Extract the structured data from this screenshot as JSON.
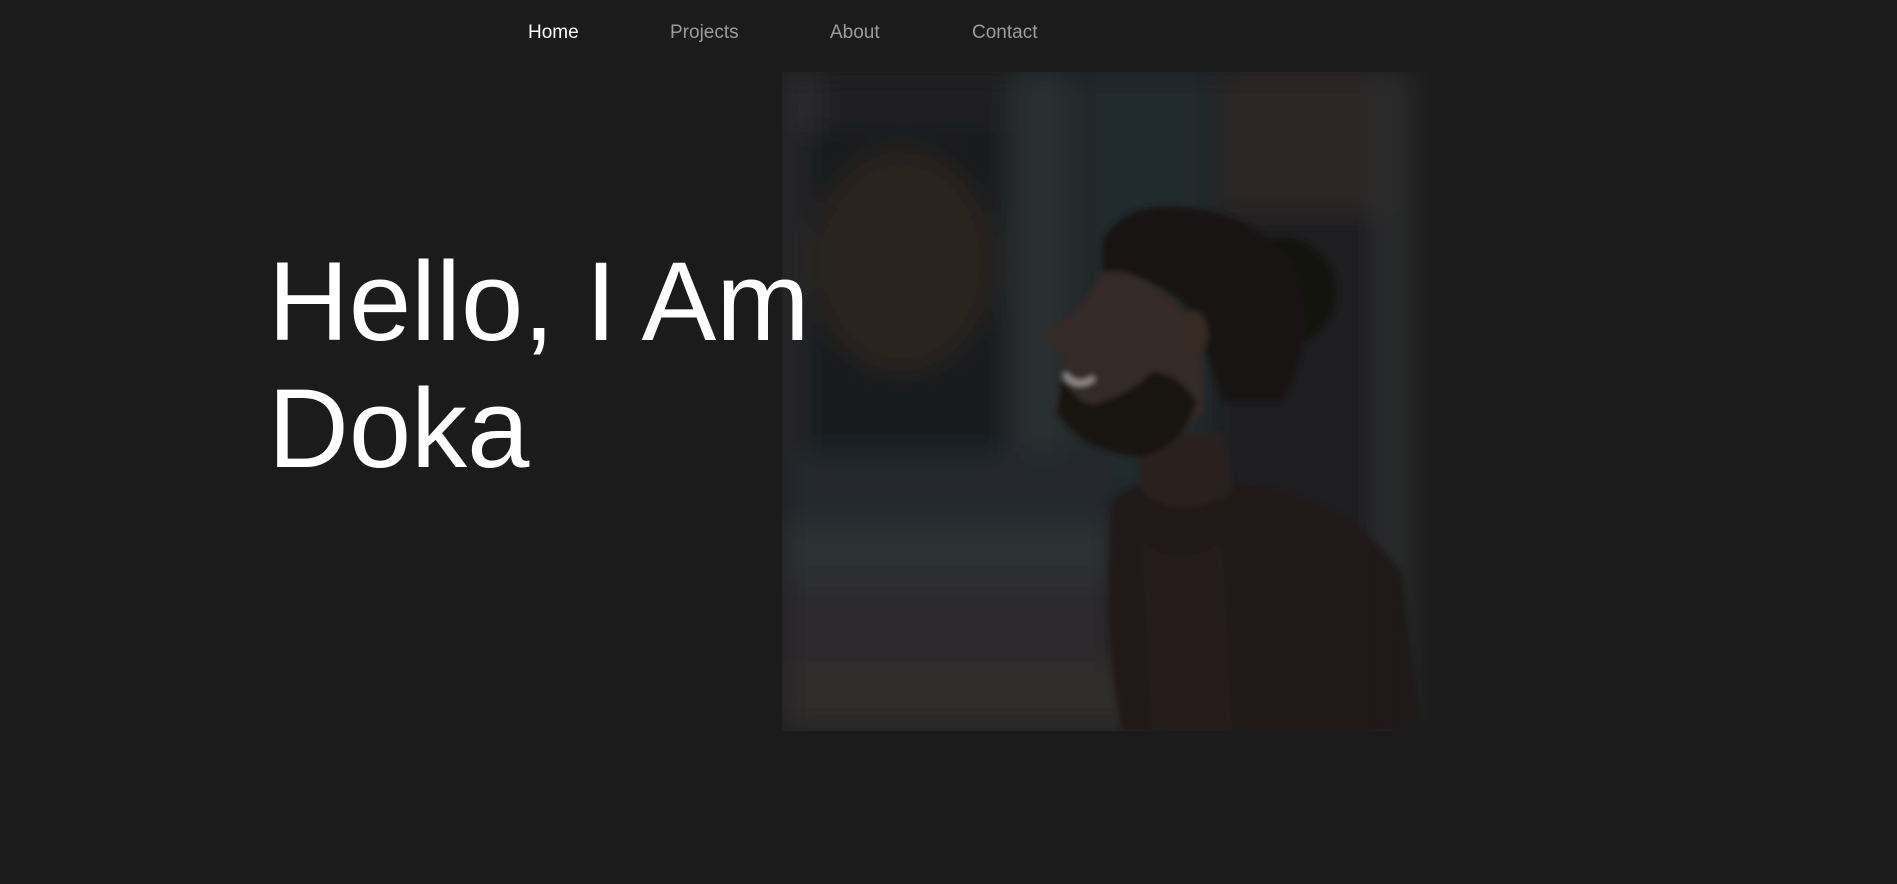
{
  "nav": {
    "items": [
      {
        "label": "Home",
        "active": true
      },
      {
        "label": "Projects",
        "active": false
      },
      {
        "label": "About",
        "active": false
      },
      {
        "label": "Contact",
        "active": false
      }
    ]
  },
  "hero": {
    "title_line1": "Hello, I Am",
    "title_line2": "Doka",
    "photo": "smiling-bearded-man-photo"
  },
  "colors": {
    "background": "#1b1b1b",
    "text": "#ffffff",
    "nav_inactive": "#9c9c9c"
  }
}
